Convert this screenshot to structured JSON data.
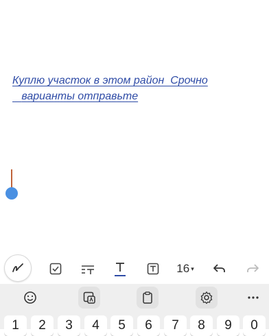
{
  "note": {
    "text": "Куплю участок в этом район  Срочно\n   варианты отправьте",
    "text_color": "#2E4BA6"
  },
  "cursor": {
    "line_color": "#C0633A",
    "handle_color": "#4A90E2"
  },
  "toolbar": {
    "tools": [
      {
        "name": "pen-mode",
        "icon": "handwriting-pen-icon"
      },
      {
        "name": "checklist",
        "icon": "checkbox-icon"
      },
      {
        "name": "text-style",
        "icon": "text-style-icon"
      },
      {
        "name": "text-underline",
        "icon": "underline-text-icon"
      },
      {
        "name": "text-box",
        "icon": "text-box-icon"
      }
    ],
    "font_size": "16",
    "font_size_arrow": "▾",
    "undo_icon": "undo-icon",
    "redo_icon": "redo-icon",
    "active_color": "#2E4BA6"
  },
  "keyboard": {
    "toolbar_icons": [
      "emoji-icon",
      "sticker-icon",
      "clipboard-icon",
      "settings-icon",
      "more-icon"
    ],
    "number_row": [
      "1",
      "2",
      "3",
      "4",
      "5",
      "6",
      "7",
      "8",
      "9",
      "0"
    ]
  }
}
